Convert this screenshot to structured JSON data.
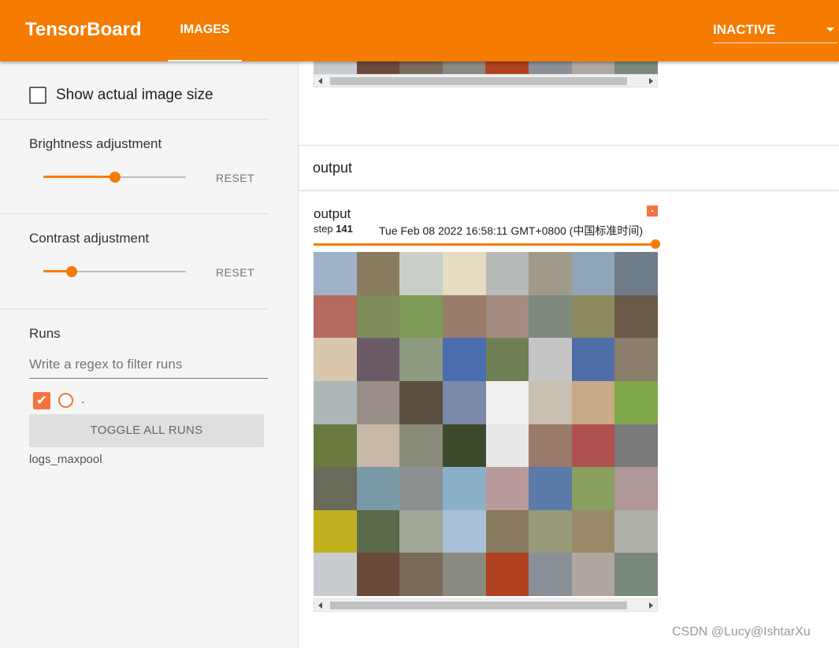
{
  "header": {
    "brand": "TensorBoard",
    "active_tab": "IMAGES",
    "status_dropdown": "INACTIVE",
    "brand_color": "#f57c00"
  },
  "sidebar": {
    "show_actual_size_label": "Show actual image size",
    "show_actual_size_checked": false,
    "brightness": {
      "title": "Brightness adjustment",
      "level": 0.5,
      "reset_label": "RESET"
    },
    "contrast": {
      "title": "Contrast adjustment",
      "level": 0.2,
      "reset_label": "RESET"
    },
    "runs": {
      "title": "Runs",
      "filter_placeholder": "Write a regex to filter runs",
      "items": [
        {
          "label": ".",
          "checked": true,
          "color": "#f4733e"
        }
      ],
      "toggle_all_label": "TOGGLE ALL RUNS",
      "log_dir": "logs_maxpool"
    }
  },
  "main": {
    "group_title": "output",
    "card": {
      "title": "output",
      "step_label": "step",
      "step_value": "141",
      "timestamp": "Tue Feb 08 2022 16:58:11 GMT+0800 (中国标准时间)"
    },
    "image_grid": {
      "rows": 8,
      "cols": 8,
      "tile_colors": [
        "#9fb2c8",
        "#8a7a5e",
        "#c9cfc7",
        "#e6dcc2",
        "#b8bcb8",
        "#a09a8a",
        "#8fa5b8",
        "#6f7d88",
        "#b46a5c",
        "#7f8d5a",
        "#7c9b56",
        "#9a7c6a",
        "#a58c80",
        "#7e8a7e",
        "#8d8a60",
        "#6b5a48",
        "#d9c7ad",
        "#6a5a66",
        "#8c9b80",
        "#4a6db0",
        "#6f8054",
        "#c5c5c5",
        "#4e6ea8",
        "#8a7e6a",
        "#aeb6b8",
        "#9a8f88",
        "#5c5040",
        "#7a8aa8",
        "#f0f0f0",
        "#c8c0b0",
        "#c9aa88",
        "#7ea84a",
        "#6a7a3e",
        "#c8b8a8",
        "#8a8a7a",
        "#3a4a2a",
        "#e8e8e8",
        "#9a7a6a",
        "#b05050",
        "#7a7a7a",
        "#6a6a5a",
        "#7a9aa8",
        "#8a9090",
        "#8ab0c8",
        "#b89a9a",
        "#5a7aa8",
        "#8aa060",
        "#b09898",
        "#c0b020",
        "#5a6a4a",
        "#a0a898",
        "#a8c0d8",
        "#8a7a60",
        "#9a9a7a",
        "#9a8a6a",
        "#b0b0a8",
        "#c8ccd0",
        "#6a4a3a",
        "#7a6a5a",
        "#8a8a80",
        "#b04020",
        "#8a9098",
        "#b0a8a0",
        "#7a8a7a"
      ]
    }
  },
  "watermark": "CSDN @Lucy@IshtarXu"
}
